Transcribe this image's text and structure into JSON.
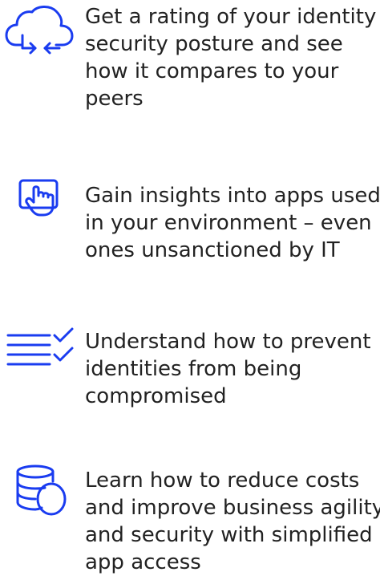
{
  "accent_color": "#1a3cf0",
  "text_color": "#222222",
  "benefits": [
    {
      "icon": "cloud-sync-icon",
      "lines": [
        "Get a rating of your identity",
        "security posture and see",
        "how it compares to your",
        "peers"
      ]
    },
    {
      "icon": "touch-screen-icon",
      "lines": [
        "Gain insights into apps used",
        "in your environment – even",
        "ones unsanctioned by IT"
      ]
    },
    {
      "icon": "checklist-icon",
      "lines": [
        "Understand how to prevent",
        "identities from being",
        "compromised"
      ]
    },
    {
      "icon": "database-icon",
      "lines": [
        "Learn how to reduce costs",
        "and improve business agility",
        "and security with simplified",
        "app access"
      ]
    }
  ]
}
